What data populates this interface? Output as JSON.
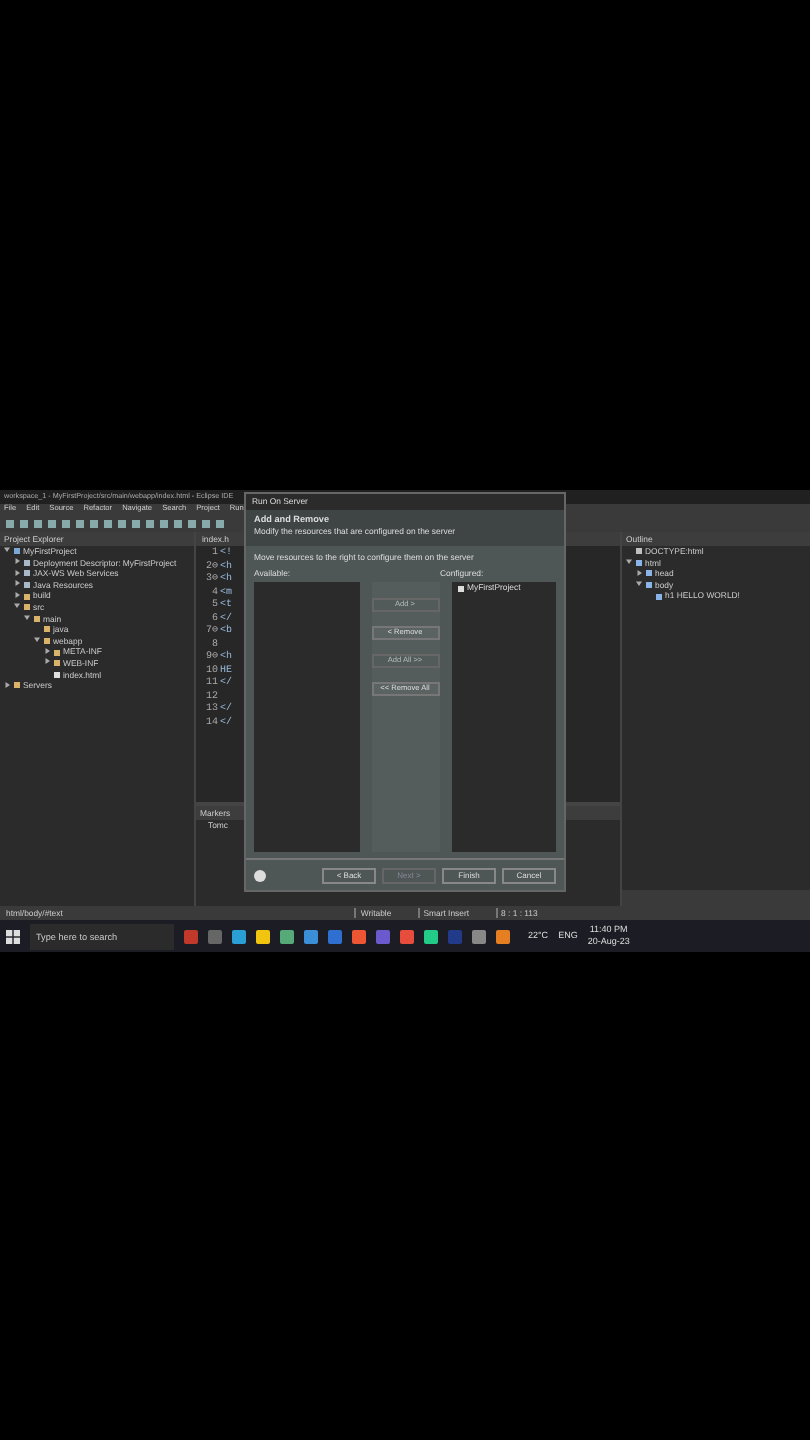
{
  "window": {
    "title": "workspace_1 - MyFirstProject/src/main/webapp/index.html - Eclipse IDE"
  },
  "menu": [
    "File",
    "Edit",
    "Source",
    "Refactor",
    "Navigate",
    "Search",
    "Project",
    "Run"
  ],
  "project_explorer": {
    "title": "Project Explorer",
    "tree": [
      {
        "label": "MyFirstProject",
        "kind": "project",
        "expanded": true,
        "children": [
          {
            "label": "Deployment Descriptor: MyFirstProject",
            "kind": "descriptor",
            "expanded": false
          },
          {
            "label": "JAX-WS Web Services",
            "kind": "descriptor",
            "expanded": false
          },
          {
            "label": "Java Resources",
            "kind": "descriptor",
            "expanded": false
          },
          {
            "label": "build",
            "kind": "folder",
            "expanded": false
          },
          {
            "label": "src",
            "kind": "folder",
            "expanded": true,
            "children": [
              {
                "label": "main",
                "kind": "folder",
                "expanded": true,
                "children": [
                  {
                    "label": "java",
                    "kind": "folder"
                  },
                  {
                    "label": "webapp",
                    "kind": "folder",
                    "expanded": true,
                    "children": [
                      {
                        "label": "META-INF",
                        "kind": "folder",
                        "expanded": false
                      },
                      {
                        "label": "WEB-INF",
                        "kind": "folder",
                        "expanded": false
                      },
                      {
                        "label": "index.html",
                        "kind": "file"
                      }
                    ]
                  }
                ]
              }
            ]
          }
        ]
      },
      {
        "label": "Servers",
        "kind": "folder",
        "expanded": false
      }
    ]
  },
  "editor": {
    "tab": "index.h",
    "lines": [
      {
        "number": "1",
        "code": "<!"
      },
      {
        "number": "2⊖",
        "code": "<h"
      },
      {
        "number": "3⊖",
        "code": "<h"
      },
      {
        "number": "4",
        "code": "<m"
      },
      {
        "number": "5",
        "code": "<t"
      },
      {
        "number": "6",
        "code": "</"
      },
      {
        "number": "7⊖",
        "code": "<b"
      },
      {
        "number": "8"
      },
      {
        "number": "9⊖",
        "code": "<h"
      },
      {
        "number": "10",
        "code": "HE"
      },
      {
        "number": "11",
        "code": "</"
      },
      {
        "number": "12"
      },
      {
        "number": "13",
        "code": "</"
      },
      {
        "number": "14",
        "code": "</"
      }
    ]
  },
  "outline": {
    "title": "Outline",
    "tree": [
      {
        "label": "DOCTYPE:html",
        "kind": "doctype"
      },
      {
        "label": "html",
        "kind": "element",
        "expanded": true,
        "children": [
          {
            "label": "head",
            "kind": "element",
            "expanded": false
          },
          {
            "label": "body",
            "kind": "element",
            "expanded": true,
            "children": [
              {
                "label": "h1 HELLO WORLD!",
                "kind": "element"
              }
            ]
          }
        ]
      }
    ]
  },
  "bottom_panel": {
    "tab": "Markers",
    "item": "Tomc"
  },
  "dialog": {
    "title": "Run On Server",
    "heading": "Add and Remove",
    "subtitle": "Modify the resources that are configured on the server",
    "instruction": "Move resources to the right to configure them on the server",
    "available_label": "Available:",
    "configured_label": "Configured:",
    "configured": [
      "MyFirstProject"
    ],
    "move_buttons": [
      {
        "label": "Add >",
        "disabled": true
      },
      {
        "label": "< Remove",
        "disabled": false
      },
      {
        "label": "Add All >>",
        "disabled": true
      },
      {
        "label": "<< Remove All",
        "disabled": false
      }
    ],
    "footer_buttons": [
      {
        "label": "< Back",
        "disabled": false
      },
      {
        "label": "Next >",
        "disabled": true
      },
      {
        "label": "Finish",
        "disabled": false
      },
      {
        "label": "Cancel",
        "disabled": false
      }
    ]
  },
  "status_bar": {
    "path": "html/body/#text",
    "fields": [
      "Writable",
      "Smart Insert",
      "8 : 1 : 113"
    ]
  },
  "taskbar": {
    "search_placeholder": "Type here to search",
    "weather": "22°C",
    "language": "ENG",
    "time": "11:40 PM",
    "date": "20-Aug-23"
  }
}
